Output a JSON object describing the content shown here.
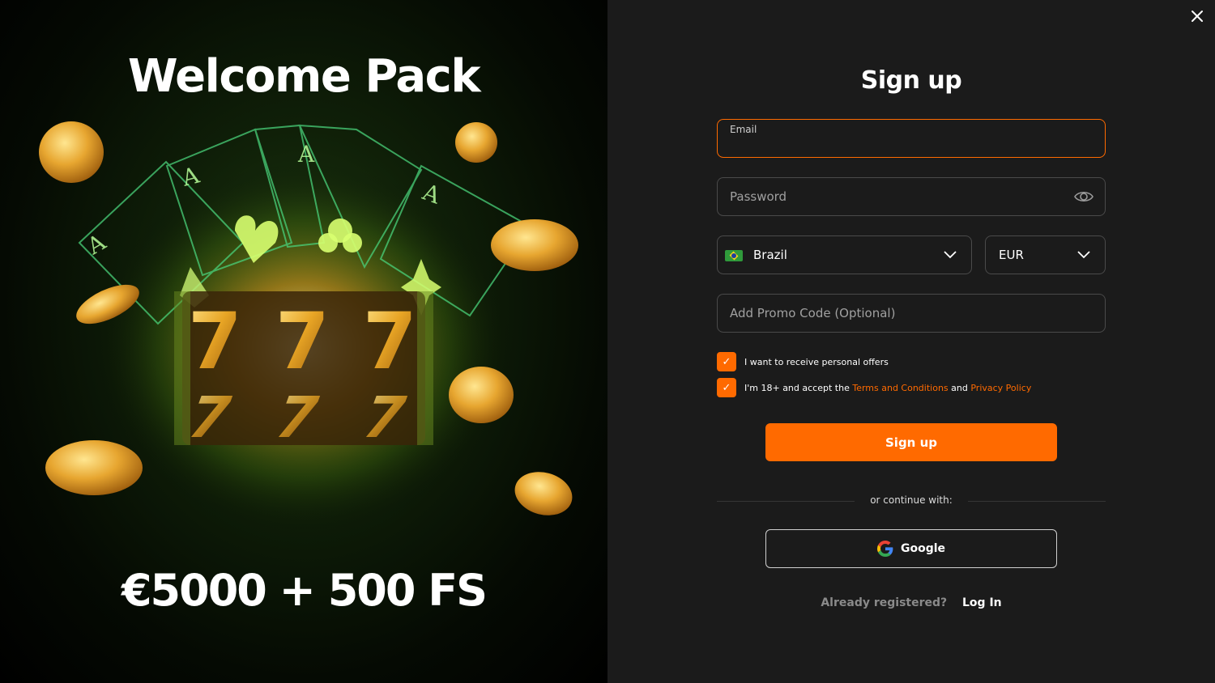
{
  "promo": {
    "title": "Welcome Pack",
    "amount": "€5000 + 500 FS"
  },
  "form": {
    "title": "Sign up",
    "email": {
      "label": "Email",
      "value": ""
    },
    "password": {
      "placeholder": "Password"
    },
    "country": {
      "value": "Brazil",
      "flag": "brazil-flag-icon"
    },
    "currency": {
      "value": "EUR"
    },
    "promo_code": {
      "placeholder": "Add Promo Code (Optional)"
    },
    "checkboxes": [
      {
        "text": "I want to receive personal offers",
        "checked": true
      },
      {
        "text_prefix": "I'm 18+ and accept the",
        "terms_link": "Terms and Conditions",
        "and": "and",
        "privacy_link": "Privacy Policy",
        "checked": true
      }
    ],
    "submit_label": "Sign up",
    "divider_text": "or continue with:",
    "google_label": "Google",
    "already_text": "Already registered?",
    "login_label": "Log In"
  },
  "colors": {
    "accent": "#ff6a00",
    "panel_bg": "#1b1b1b",
    "field_border": "#4a4a4a"
  }
}
